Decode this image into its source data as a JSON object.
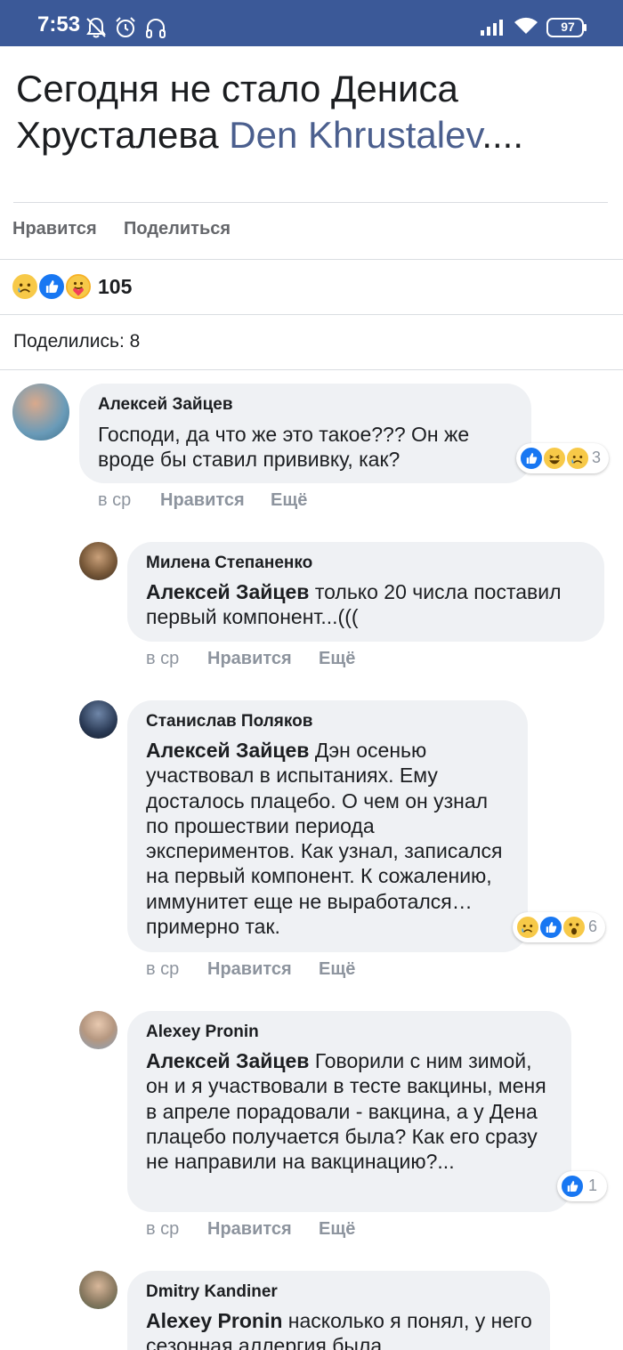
{
  "status_bar": {
    "time": "7:53",
    "battery": "97"
  },
  "post": {
    "title_text": "Сегодня не стало Дениса Хрусталева ",
    "title_link": "Den Khrustalev",
    "title_suffix": "....",
    "actions": {
      "like": "Нравится",
      "share": "Поделиться"
    },
    "reactions_count": "105",
    "shares_label": "Поделились: 8"
  },
  "comments": [
    {
      "author": "Алексей Зайцев",
      "mention": "",
      "text": "Господи, да что же это такое??? Он же вроде бы ставил прививку, как?",
      "time": "в ср",
      "like": "Нравится",
      "more": "Ещё",
      "reactions_count": "3",
      "reactions": [
        "like-icon",
        "haha-icon",
        "sad-icon"
      ]
    },
    {
      "author": "Милена Степаненко",
      "mention": "Алексей Зайцев",
      "text": " только 20 числа поставил первый компонент...(((",
      "time": "в ср",
      "like": "Нравится",
      "more": "Ещё"
    },
    {
      "author": "Станислав Поляков",
      "mention": "Алексей Зайцев",
      "text": " Дэн осенью участвовал в испытаниях. Ему досталось плацебо. О чем он узнал по прошествии периода экспериментов. Как узнал, записался на первый компонент. К сожалению, иммунитет еще не выработался… примерно так.",
      "time": "в ср",
      "like": "Нравится",
      "more": "Ещё",
      "reactions_count": "6",
      "reactions": [
        "sad-icon",
        "like-icon",
        "wow-icon"
      ]
    },
    {
      "author": "Alexey Pronin",
      "mention": "Алексей Зайцев",
      "text": " Говорили с ним зимой, он и я участвовали в тесте вакцины, меня в апреле порадовали - вакцина, а у Дена плацебо получается была? Как его сразу не направили на вакцинацию?...",
      "time": "в ср",
      "like": "Нравится",
      "more": "Ещё",
      "reactions_count": "1",
      "reactions": [
        "like-icon"
      ]
    },
    {
      "author": "Dmitry Kandiner",
      "mention": "Alexey Pronin",
      "text": " насколько я понял, у него сезонная аллергия была",
      "time": "",
      "like": "",
      "more": ""
    }
  ],
  "colors": {
    "status_bar": "#3b5998",
    "link": "#4b5f8e",
    "bubble": "#eff1f4",
    "like": "#1877f2"
  }
}
